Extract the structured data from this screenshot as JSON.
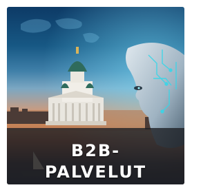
{
  "card": {
    "title_line1": "B2B-",
    "title_line2": "PALVELUT"
  },
  "colors": {
    "sky_top": "#0d3a66",
    "sunset": "#e0915a",
    "band": "#1e2026",
    "text": "#ffffff",
    "circuit_glow": "#38d6e8"
  },
  "image": {
    "subject": "helsinki-cathedral-and-ai-android-head"
  }
}
